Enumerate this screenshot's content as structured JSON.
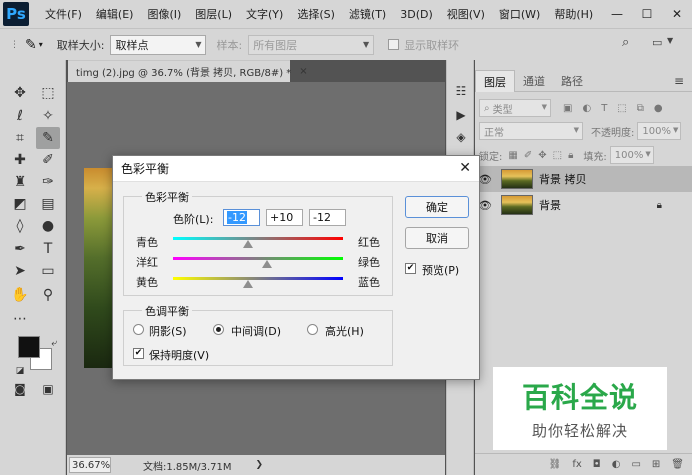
{
  "app": {
    "logo": "Ps",
    "menu": [
      "文件(F)",
      "编辑(E)",
      "图像(I)",
      "图层(L)",
      "文字(Y)",
      "选择(S)",
      "滤镜(T)",
      "3D(D)",
      "视图(V)",
      "窗口(W)",
      "帮助(H)"
    ],
    "window_controls": [
      "—",
      "☐",
      "✕"
    ]
  },
  "options_bar": {
    "sample_size_label": "取样大小:",
    "sample_size_value": "取样点",
    "sample_label": "样本:",
    "sample_value": "所有图层",
    "show_ring_label": "显示取样环"
  },
  "document": {
    "tab_title": "timg (2).jpg @ 36.7% (背景 拷贝, RGB/8#) *",
    "tab_close": "×",
    "zoom": "36.67%",
    "doc_info": "文档:1.85M/3.71M"
  },
  "layers_panel": {
    "tabs": [
      "图层",
      "通道",
      "路径"
    ],
    "filter_kind": "类型",
    "blend_mode": "正常",
    "opacity_label": "不透明度:",
    "opacity_value": "100%",
    "lock_label": "锁定:",
    "fill_label": "填充:",
    "fill_value": "100%",
    "layers": [
      {
        "name": "背景 拷贝",
        "selected": true,
        "locked": false
      },
      {
        "name": "背景",
        "selected": false,
        "locked": true
      }
    ],
    "bottom_icons": [
      "link-icon",
      "fx-icon",
      "mask-icon",
      "adjustment-icon",
      "folder-icon",
      "new-layer-icon",
      "trash-icon"
    ]
  },
  "dialog": {
    "title": "色彩平衡",
    "close": "✕",
    "color_balance_group": "色彩平衡",
    "levels_label": "色阶(L):",
    "levels": [
      "-12",
      "+10",
      "-12"
    ],
    "sliders": [
      {
        "left": "青色",
        "right": "红色",
        "value": -12
      },
      {
        "left": "洋红",
        "right": "绿色",
        "value": 10
      },
      {
        "left": "黄色",
        "right": "蓝色",
        "value": -12
      }
    ],
    "tone_balance_group": "色调平衡",
    "tones": [
      "阴影(S)",
      "中间调(D)",
      "高光(H)"
    ],
    "selected_tone": "中间调(D)",
    "preserve_luminosity": "保持明度(V)",
    "ok": "确定",
    "cancel": "取消",
    "preview": "预览(P)"
  },
  "watermark": {
    "title": "百科全说",
    "subtitle": "助你轻松解决"
  }
}
